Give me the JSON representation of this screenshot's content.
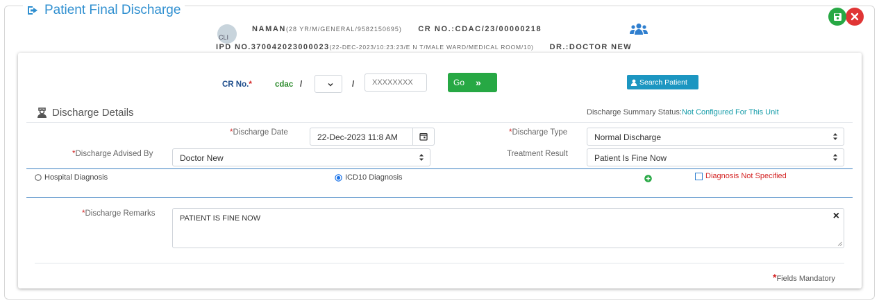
{
  "page": {
    "title": "Patient Final Discharge"
  },
  "patient": {
    "avatar_alt": "CLI",
    "name": "NAMAN",
    "name_detail": "(28 YR/M/GENERAL/9582150695)",
    "cr_no": "CR NO.:CDAC/23/00000218",
    "ipd_no": "IPD NO.370042023000023",
    "ipd_detail": "(22-DEC-2023/10:23:23/E N T/MALE WARD/MEDICAL ROOM/10)",
    "doctor": "DR.:DOCTOR NEW"
  },
  "search": {
    "cr_label": "CR No.",
    "cr_required": "*",
    "cr_prefix": "cdac",
    "slash1": "/",
    "slash2": "/",
    "year_value": "",
    "number_placeholder": "XXXXXXXX",
    "go_label": "Go",
    "go_icon": "»",
    "search_patient_label": "Search Patient"
  },
  "discharge": {
    "section_title": "Discharge Details",
    "summary_status_label": "Discharge Summary Status:",
    "summary_status_value": "Not Configured For This Unit",
    "date_label": "Discharge Date",
    "date_value": "22-Dec-2023 11:8 AM",
    "type_label": "Discharge Type",
    "type_value": "Normal Discharge",
    "advised_by_label": "Discharge Advised By",
    "advised_by_value": "Doctor New",
    "treatment_label": "Treatment Result",
    "treatment_value": "Patient Is Fine Now",
    "hospital_diagnosis_label": "Hospital Diagnosis",
    "icd10_diagnosis_label": "ICD10 Diagnosis",
    "diagnosis_not_specified_label": "Diagnosis Not Specified",
    "remarks_label": "Discharge Remarks",
    "remarks_value": "PATIENT IS FINE NOW",
    "clear_symbol": "×",
    "mandatory_note": "Fields Mandatory",
    "required_mark": "*"
  },
  "colors": {
    "title_blue": "#2f8fd0",
    "go_green": "#27a844",
    "search_teal": "#1c96c1",
    "status_teal": "#139ba8",
    "required_red": "#d42424",
    "cr_label_blue": "#1f4e8c"
  },
  "icons": {
    "title": "sign-out-icon",
    "users": "users-icon",
    "save": "save-icon",
    "close": "close-icon",
    "calendar": "calendar-icon",
    "section": "user-nurse-icon",
    "add": "plus-circle-icon"
  }
}
